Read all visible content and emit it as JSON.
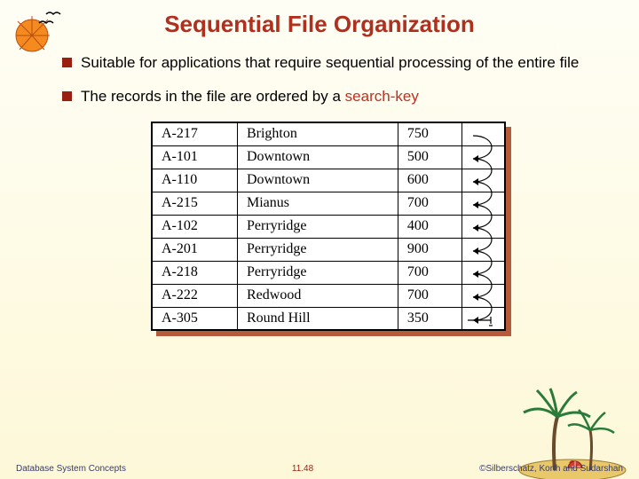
{
  "title": "Sequential File Organization",
  "bullets": [
    {
      "text": "Suitable for applications that require sequential processing of the entire file",
      "has_keyword": false
    },
    {
      "prefix": "The records in the file are ordered by a ",
      "keyword": "search-key"
    }
  ],
  "records": [
    {
      "id": "A-217",
      "loc": "Brighton",
      "val": "750"
    },
    {
      "id": "A-101",
      "loc": "Downtown",
      "val": "500"
    },
    {
      "id": "A-110",
      "loc": "Downtown",
      "val": "600"
    },
    {
      "id": "A-215",
      "loc": "Mianus",
      "val": "700"
    },
    {
      "id": "A-102",
      "loc": "Perryridge",
      "val": "400"
    },
    {
      "id": "A-201",
      "loc": "Perryridge",
      "val": "900"
    },
    {
      "id": "A-218",
      "loc": "Perryridge",
      "val": "700"
    },
    {
      "id": "A-222",
      "loc": "Redwood",
      "val": "700"
    },
    {
      "id": "A-305",
      "loc": "Round Hill",
      "val": "350"
    }
  ],
  "footer": {
    "left": "Database System Concepts",
    "center": "11.48",
    "right": "©Silberschatz, Korth and Sudarshan"
  }
}
